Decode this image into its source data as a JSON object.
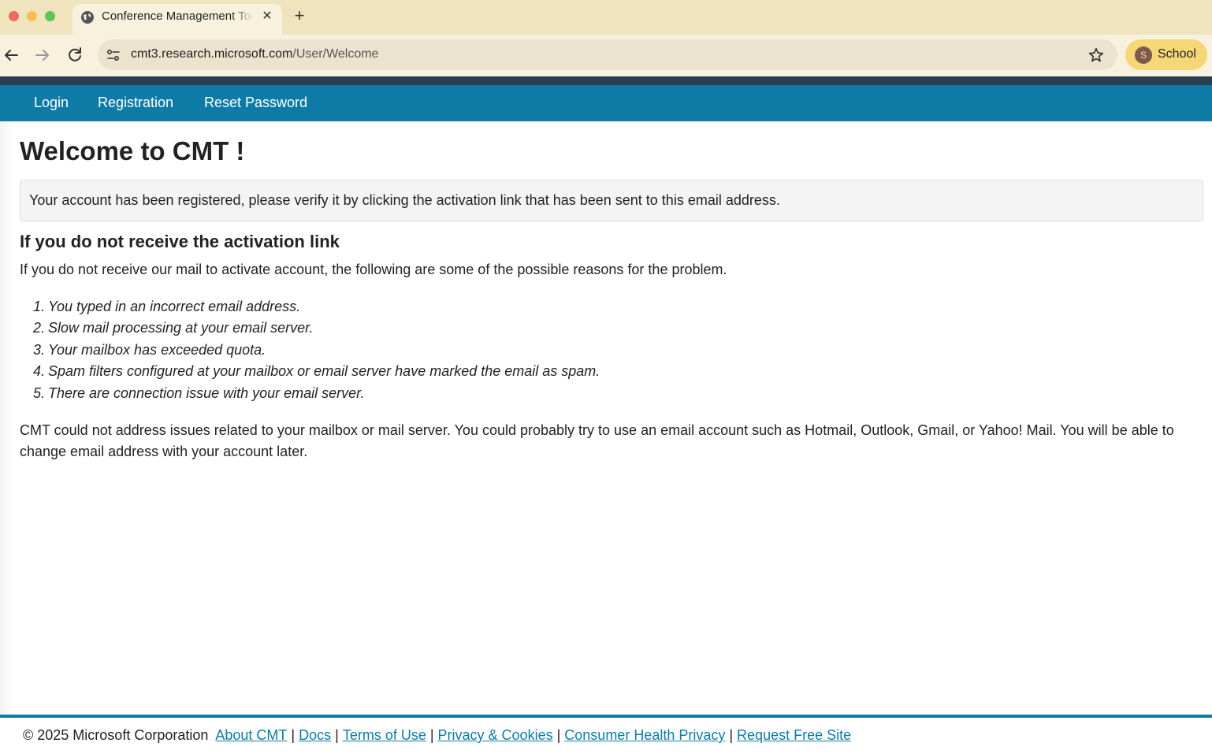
{
  "browser": {
    "tab_title": "Conference Management Tool",
    "new_tab_label": "+",
    "url_host": "cmt3.research.microsoft.com",
    "url_path": "/User/Welcome",
    "profile_initial": "S",
    "profile_label": "School"
  },
  "nav": {
    "links": [
      "Login",
      "Registration",
      "Reset Password"
    ],
    "bar_color": "#0d7ba6"
  },
  "main": {
    "title": "Welcome to CMT !",
    "alert": "Your account has been registered, please verify it by clicking the activation link that has been sent to this email address.",
    "subtitle": "If you do not receive the activation link",
    "intro": "If you do not receive our mail to activate account, the following are some of the possible reasons for the problem.",
    "reasons": [
      "You typed in an incorrect email address.",
      "Slow mail processing at your email server.",
      "Your mailbox has exceeded quota.",
      "Spam filters configured at your mailbox or email server have marked the email as spam.",
      "There are connection issue with your email server."
    ],
    "closing": "CMT could not address issues related to your mailbox or mail server. You could probably try to use an email account such as Hotmail, Outlook, Gmail, or Yahoo! Mail. You will be able to change email address with your account later."
  },
  "footer": {
    "copyright": "© 2025 Microsoft Corporation",
    "links": [
      "About CMT",
      "Docs",
      "Terms of Use",
      "Privacy & Cookies",
      "Consumer Health Privacy",
      "Request Free Site"
    ],
    "separator": "|"
  }
}
